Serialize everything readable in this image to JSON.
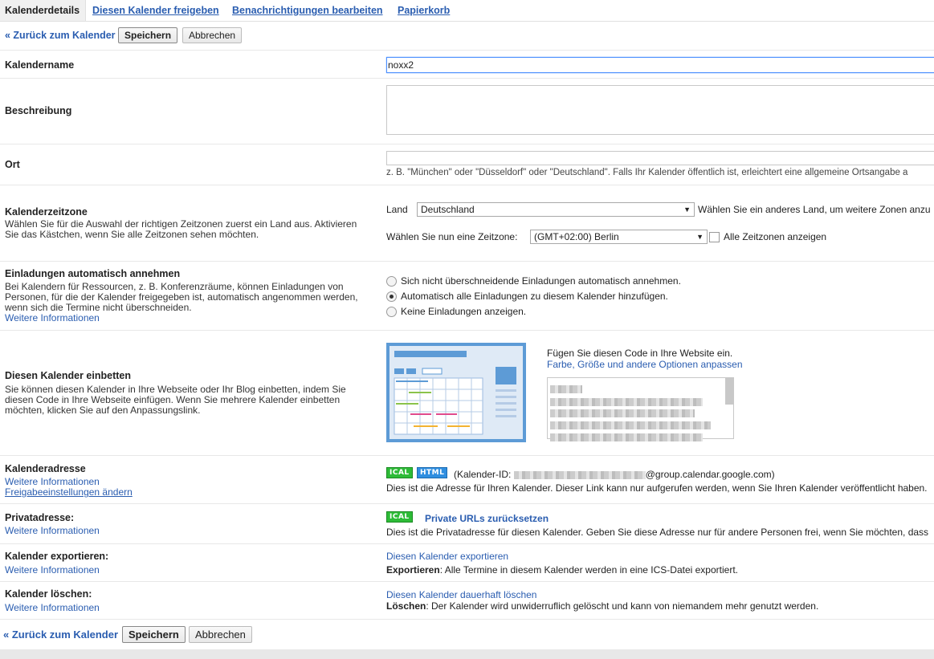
{
  "tabs": {
    "active": "Kalenderdetails",
    "share": "Diesen Kalender freigeben",
    "notifications": "Benachrichtigungen bearbeiten",
    "trash": "Papierkorb"
  },
  "toolbar": {
    "back": "« Zurück zum Kalender",
    "save": "Speichern",
    "cancel": "Abbrechen"
  },
  "name": {
    "label": "Kalendername",
    "value": "noxx2"
  },
  "description": {
    "label": "Beschreibung",
    "value": ""
  },
  "location": {
    "label": "Ort",
    "value": "",
    "hint": "z. B. \"München\" oder \"Düsseldorf\" oder \"Deutschland\". Falls Ihr Kalender öffentlich ist, erleichtert eine allgemeine Ortsangabe a"
  },
  "timezone": {
    "label": "Kalenderzeitzone",
    "desc": "Wählen Sie für die Auswahl der richtigen Zeitzonen zuerst ein Land aus. Aktivieren Sie das Kästchen, wenn Sie alle Zeitzonen sehen möchten.",
    "country_label": "Land",
    "country": "Deutschland",
    "country_hint": "Wählen Sie ein anderes Land, um weitere Zonen anzu",
    "zone_label": "Wählen Sie nun eine Zeitzone:",
    "zone": "(GMT+02:00) Berlin",
    "all_zones": "Alle Zeitzonen anzeigen"
  },
  "invites": {
    "label": "Einladungen automatisch annehmen",
    "desc": "Bei Kalendern für Ressourcen, z. B. Konferenzräume, können Einladungen von Personen, für die der Kalender freigegeben ist, automatisch angenommen werden, wenn sich die Termine nicht überschneiden.",
    "more": "Weitere Informationen",
    "opt1": "Sich nicht überschneidende Einladungen automatisch annehmen.",
    "opt2": "Automatisch alle Einladungen zu diesem Kalender hinzufügen.",
    "opt3": "Keine Einladungen anzeigen."
  },
  "embed": {
    "label": "Diesen Kalender einbetten",
    "desc": "Sie können diesen Kalender in Ihre Webseite oder Ihr Blog einbetten, indem Sie diesen Code in Ihre Webseite einfügen. Wenn Sie mehrere Kalender einbetten möchten, klicken Sie auf den Anpassungslink.",
    "paste": "Fügen Sie diesen Code in Ihre Website ein.",
    "customize": "Farbe, Größe und andere Optionen anpassen"
  },
  "address": {
    "label": "Kalenderadresse",
    "more": "Weitere Informationen",
    "share_settings": "Freigabeeinstellungen ändern",
    "ical": "ICAL",
    "html": "HTML",
    "id_prefix": "(Kalender-ID:",
    "id_suffix": "@group.calendar.google.com)",
    "info": "Dies ist die Adresse für Ihren Kalender. Dieser Link kann nur aufgerufen werden, wenn Sie Ihren Kalender veröffentlicht haben."
  },
  "private": {
    "label": "Privatadresse:",
    "more": "Weitere Informationen",
    "ical": "ICAL",
    "reset": "Private URLs zurücksetzen",
    "info": "Dies ist die Privatadresse für diesen Kalender. Geben Sie diese Adresse nur für andere Personen frei, wenn Sie möchten, dass"
  },
  "export": {
    "label": "Kalender exportieren:",
    "more": "Weitere Informationen",
    "link": "Diesen Kalender exportieren",
    "bold": "Exportieren",
    "info": ": Alle Termine in diesem Kalender werden in eine ICS-Datei exportiert."
  },
  "delete": {
    "label": "Kalender löschen:",
    "more": "Weitere Informationen",
    "link": "Diesen Kalender dauerhaft löschen",
    "bold": "Löschen",
    "info": ": Der Kalender wird unwiderruflich gelöscht und kann von niemandem mehr genutzt werden."
  }
}
